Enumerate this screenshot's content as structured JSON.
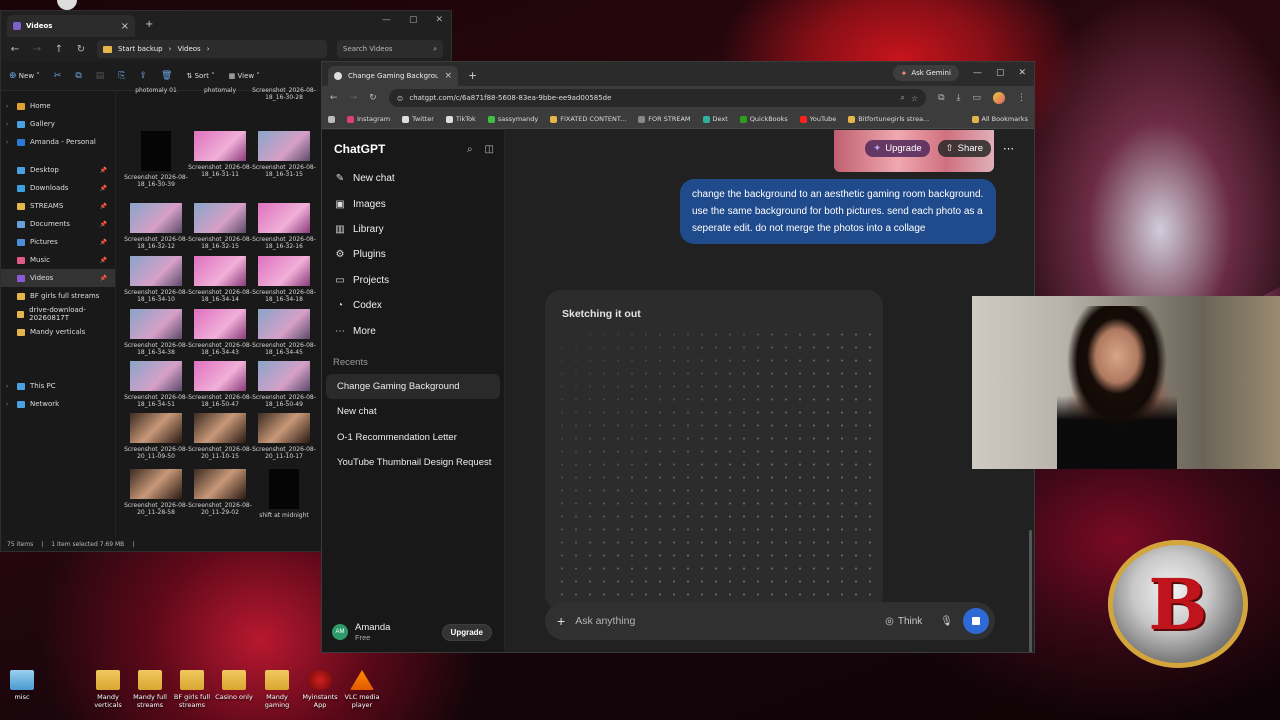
{
  "explorer": {
    "tab_title": "Videos",
    "breadcrumb": [
      "Start backup",
      "Videos"
    ],
    "search_placeholder": "Search Videos",
    "toolbar": {
      "new": "New",
      "sort": "Sort",
      "view": "View"
    },
    "nav": [
      {
        "label": "Home",
        "color": "#e0a030"
      },
      {
        "label": "Gallery",
        "color": "#4aa0e0"
      },
      {
        "label": "Amanda - Personal",
        "color": "#2a7ad6"
      },
      {
        "label": "Desktop",
        "color": "#4aa0e0"
      },
      {
        "label": "Downloads",
        "color": "#3aa0e0"
      },
      {
        "label": "STREAMS",
        "color": "#e6b54a"
      },
      {
        "label": "Documents",
        "color": "#6aa0d8"
      },
      {
        "label": "Pictures",
        "color": "#4a90d8"
      },
      {
        "label": "Music",
        "color": "#e05a8a"
      },
      {
        "label": "Videos",
        "color": "#8a5ad8"
      },
      {
        "label": "BF girls full streams",
        "color": "#e6b54a"
      },
      {
        "label": "drive-download-20260817T",
        "color": "#e6b54a"
      },
      {
        "label": "Mandy verticals",
        "color": "#e6b54a"
      },
      {
        "label": "This PC",
        "color": "#4aa0e0"
      },
      {
        "label": "Network",
        "color": "#4aa0e0"
      }
    ],
    "thumbnails": [
      {
        "label": "photomaly 01",
        "kind": "none"
      },
      {
        "label": "photomaly",
        "kind": "none"
      },
      {
        "label": "Screenshot_2026-08-18_16-30-28",
        "kind": "none"
      },
      {
        "label": "Screenshot_2026-08-18_16-30-39",
        "kind": "black"
      },
      {
        "label": "Screenshot_2026-08-18_16-31-11",
        "kind": "pink"
      },
      {
        "label": "Screenshot_2026-08-18_16-31-15",
        "kind": "normal"
      },
      {
        "label": "Screenshot_2026-08-18_16-32-12",
        "kind": "normal"
      },
      {
        "label": "Screenshot_2026-08-18_16-32-15",
        "kind": "normal"
      },
      {
        "label": "Screenshot_2026-08-18_16-32-16",
        "kind": "pink"
      },
      {
        "label": "Screenshot_2026-08-18_16-34-10",
        "kind": "normal"
      },
      {
        "label": "Screenshot_2026-08-18_16-34-14",
        "kind": "pink"
      },
      {
        "label": "Screenshot_2026-08-18_16-34-18",
        "kind": "pink"
      },
      {
        "label": "Screenshot_2026-08-18_16-34-38",
        "kind": "normal"
      },
      {
        "label": "Screenshot_2026-08-18_16-34-43",
        "kind": "pink"
      },
      {
        "label": "Screenshot_2026-08-18_16-34-45",
        "kind": "normal"
      },
      {
        "label": "Screenshot_2026-08-18_16-34-51",
        "kind": "normal"
      },
      {
        "label": "Screenshot_2026-08-18_16-50-47",
        "kind": "pink"
      },
      {
        "label": "Screenshot_2026-08-18_16-50-49",
        "kind": "normal"
      },
      {
        "label": "Screenshot_2026-08-20_11-09-50",
        "kind": "dark"
      },
      {
        "label": "Screenshot_2026-08-20_11-10-15",
        "kind": "dark"
      },
      {
        "label": "Screenshot_2026-08-20_11-10-17",
        "kind": "dark"
      },
      {
        "label": "Screenshot_2026-08-20_11-28-58",
        "kind": "dark"
      },
      {
        "label": "Screenshot_2026-08-20_11-29-02",
        "kind": "dark"
      },
      {
        "label": "shift at midnight",
        "kind": "black"
      }
    ],
    "status": {
      "count": "75 items",
      "selected": "1 item selected  7.69 MB"
    }
  },
  "chrome": {
    "tab_title": "Change Gaming Background",
    "ask_gemini": "Ask Gemini",
    "url": "chatgpt.com/c/6a871f88-5608-83ea-9bbe-ee9ad00585de",
    "bookmarks": [
      {
        "label": "Instagram",
        "color": "#e0407a"
      },
      {
        "label": "Twitter",
        "color": "#dddddd"
      },
      {
        "label": "TikTok",
        "color": "#dddddd"
      },
      {
        "label": "sassymandy",
        "color": "#40c040"
      },
      {
        "label": "FIXATED CONTENT...",
        "color": "#e6b54a"
      },
      {
        "label": "FOR STREAM",
        "color": "#888888"
      },
      {
        "label": "Dext",
        "color": "#30b0a0"
      },
      {
        "label": "QuickBooks",
        "color": "#2ca01c"
      },
      {
        "label": "YouTube",
        "color": "#ff2020"
      },
      {
        "label": "Bitfortunegirls strea...",
        "color": "#e6b54a"
      }
    ],
    "all_bookmarks": "All Bookmarks"
  },
  "chatgpt": {
    "logo": "ChatGPT",
    "menu": [
      {
        "label": "New chat",
        "icon": "✎"
      },
      {
        "label": "Images",
        "icon": "▣"
      },
      {
        "label": "Library",
        "icon": "▥"
      },
      {
        "label": "Plugins",
        "icon": "⚙"
      },
      {
        "label": "Projects",
        "icon": "▭"
      },
      {
        "label": "Codex",
        "icon": "◔"
      },
      {
        "label": "More",
        "icon": "⋯"
      }
    ],
    "recents_label": "Recents",
    "recents": [
      "Change Gaming Background",
      "New chat",
      "O-1 Recommendation Letter",
      "YouTube Thumbnail Design Request"
    ],
    "user": {
      "initials": "AM",
      "name": "Amanda",
      "plan": "Free",
      "upgrade": "Upgrade"
    },
    "header": {
      "upgrade": "Upgrade",
      "share": "Share"
    },
    "message": "change the background to an aesthetic gaming room background. use the same background for both pictures. send each photo as a seperate edit. do not merge the photos into a collage",
    "status": "Sketching it out",
    "composer": {
      "placeholder": "Ask anything",
      "think": "Think"
    }
  },
  "desktop_icons": [
    {
      "label": "misc",
      "kind": "misc"
    },
    {
      "label": "Mandy verticals",
      "kind": "folder"
    },
    {
      "label": "Mandy full streams",
      "kind": "folder"
    },
    {
      "label": "BF girls full streams",
      "kind": "folder"
    },
    {
      "label": "Casino only",
      "kind": "folder"
    },
    {
      "label": "Mandy gaming",
      "kind": "folder"
    },
    {
      "label": "Myinstants App",
      "kind": "app"
    },
    {
      "label": "VLC media player",
      "kind": "vlc"
    }
  ]
}
